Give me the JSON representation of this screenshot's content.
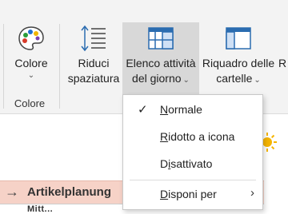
{
  "ribbon": {
    "colore_button": "Colore",
    "colore_group_label": "Colore",
    "riduci_line1": "Riduci",
    "riduci_line2": "spaziatura",
    "elenco_line1": "Elenco attività",
    "elenco_line2": "del giorno",
    "riquadro_line1": "Riquadro delle",
    "riquadro_line2": "cartelle",
    "cut_letter": "R"
  },
  "menu": {
    "items": [
      {
        "first": "N",
        "rest": "ormale",
        "checked": true
      },
      {
        "first": "R",
        "rest": "idotto a icona"
      },
      {
        "pre": "D",
        "mid": "i",
        "rest": "sattivato"
      },
      {
        "first": "D",
        "rest": "isponi per",
        "submenu": true
      }
    ]
  },
  "content": {
    "band_text": "Artikelplanung",
    "row_fragment": "Mitt..."
  },
  "colors": {
    "ribbon_bg": "#f3f3f3",
    "active_bg": "#d8d8d8",
    "band_bg": "#f6d2c7",
    "icon_blue": "#2b6cb0"
  },
  "icons": {
    "colore": "palette-icon",
    "riduci": "line-spacing-icon",
    "elenco": "todo-bar-layout-icon",
    "riquadro": "folder-pane-layout-icon",
    "check": "checkmark-icon",
    "submenu": "chevron-right-icon",
    "sun": "sun-icon",
    "arrow": "arrow-right-icon"
  }
}
